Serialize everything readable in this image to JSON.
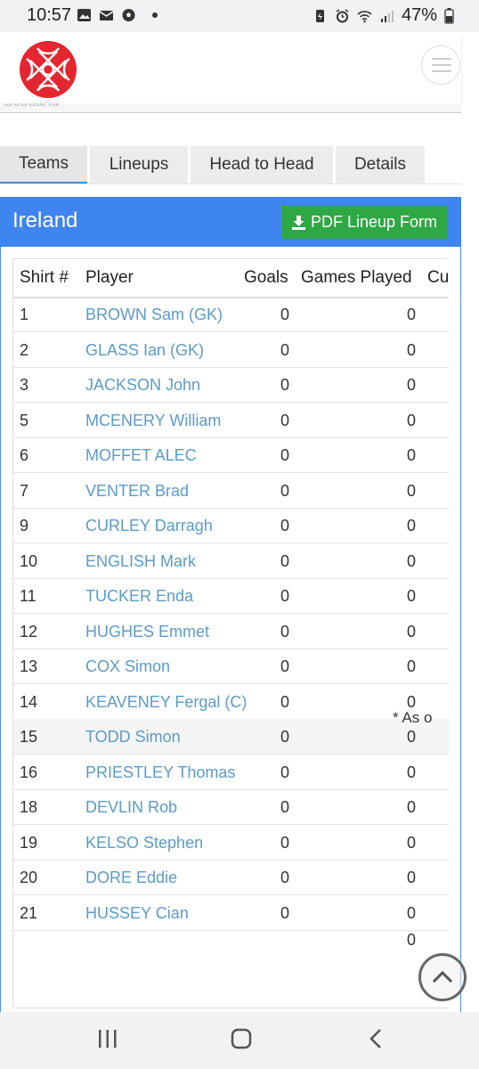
{
  "status_bar": {
    "time": "10:57",
    "battery": "47%",
    "left_icons": [
      "image-icon",
      "mail-icon",
      "soccer-ball-icon",
      "dot-icon"
    ],
    "right_icons": [
      "battery-saver-icon",
      "alarm-icon",
      "wifi-icon",
      "signal-icon",
      "battery-icon"
    ]
  },
  "header": {
    "logo": "celtic-knot-logo",
    "menu_icon": "hamburger-menu-icon",
    "strip_text": "Scotland"
  },
  "tabs": [
    {
      "label": "Teams",
      "active": true
    },
    {
      "label": "Lineups",
      "active": false
    },
    {
      "label": "Head to Head",
      "active": false
    },
    {
      "label": "Details",
      "active": false
    }
  ],
  "panel": {
    "title": "Ireland",
    "pdf_button": "PDF Lineup Form",
    "pdf_icon": "download-icon"
  },
  "table": {
    "columns": [
      "Shirt #",
      "Player",
      "Goals",
      "Games Played",
      "Cu"
    ],
    "rows": [
      {
        "shirt": "1",
        "player": "BROWN Sam (GK)",
        "goals": "0",
        "games": "0"
      },
      {
        "shirt": "2",
        "player": "GLASS Ian (GK)",
        "goals": "0",
        "games": "0"
      },
      {
        "shirt": "3",
        "player": "JACKSON John",
        "goals": "0",
        "games": "0"
      },
      {
        "shirt": "5",
        "player": "MCENERY William",
        "goals": "0",
        "games": "0"
      },
      {
        "shirt": "6",
        "player": "MOFFET ALEC",
        "goals": "0",
        "games": "0"
      },
      {
        "shirt": "7",
        "player": "VENTER Brad",
        "goals": "0",
        "games": "0"
      },
      {
        "shirt": "9",
        "player": "CURLEY Darragh",
        "goals": "0",
        "games": "0"
      },
      {
        "shirt": "10",
        "player": "ENGLISH Mark",
        "goals": "0",
        "games": "0"
      },
      {
        "shirt": "11",
        "player": "TUCKER Enda",
        "goals": "0",
        "games": "0"
      },
      {
        "shirt": "12",
        "player": "HUGHES Emmet",
        "goals": "0",
        "games": "0"
      },
      {
        "shirt": "13",
        "player": "COX Simon",
        "goals": "0",
        "games": "0"
      },
      {
        "shirt": "14",
        "player": "KEAVENEY Fergal (C)",
        "goals": "0",
        "games": "0"
      },
      {
        "shirt": "15",
        "player": "TODD Simon",
        "goals": "0",
        "games": "0"
      },
      {
        "shirt": "16",
        "player": "PRIESTLEY Thomas",
        "goals": "0",
        "games": "0"
      },
      {
        "shirt": "18",
        "player": "DEVLIN Rob",
        "goals": "0",
        "games": "0"
      },
      {
        "shirt": "19",
        "player": "KELSO Stephen",
        "goals": "0",
        "games": "0"
      },
      {
        "shirt": "20",
        "player": "DORE Eddie",
        "goals": "0",
        "games": "0"
      },
      {
        "shirt": "21",
        "player": "HUSSEY Cian",
        "goals": "0",
        "games": "0"
      }
    ],
    "total_games": "0",
    "footnote": "* As o"
  },
  "scroll_top_icon": "chevron-up-icon",
  "nav_bar": {
    "icons": [
      "recent-apps-icon",
      "home-icon",
      "back-icon"
    ]
  },
  "colors": {
    "panel_header": "#3f85f0",
    "pdf_button": "#2ea845",
    "player_link": "#5b9bc8",
    "logo_red": "#e3262f"
  }
}
